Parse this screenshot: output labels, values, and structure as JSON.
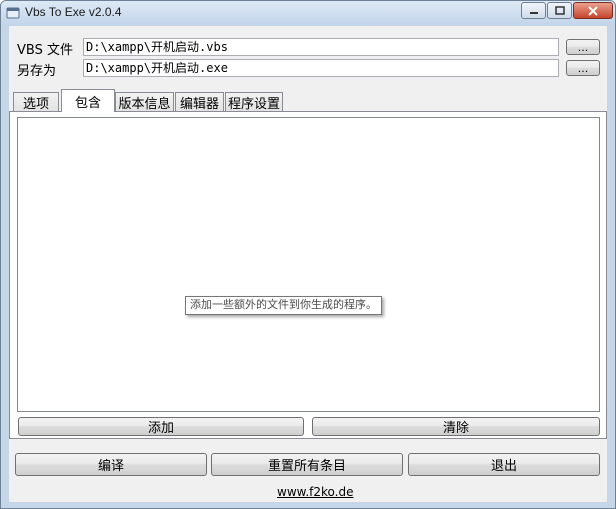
{
  "window": {
    "title": "Vbs To Exe v2.0.4",
    "titlebar_color": "#c6d6e9"
  },
  "form": {
    "vbs_label": "VBS 文件",
    "vbs_value": "D:\\xampp\\开机启动.vbs",
    "saveas_label": "另存为",
    "saveas_value": "D:\\xampp\\开机启动.exe",
    "browse_label": "..."
  },
  "tabs": [
    {
      "label": "选项"
    },
    {
      "label": "包含",
      "selected": true
    },
    {
      "label": "版本信息"
    },
    {
      "label": "编辑器"
    },
    {
      "label": "程序设置"
    }
  ],
  "include_panel": {
    "tooltip": "添加一些额外的文件到你生成的程序。",
    "add_label": "添加",
    "clear_label": "清除"
  },
  "footer": {
    "compile_label": "编译",
    "reset_label": "重置所有条目",
    "exit_label": "退出",
    "link_text": "www.f2ko.de"
  }
}
